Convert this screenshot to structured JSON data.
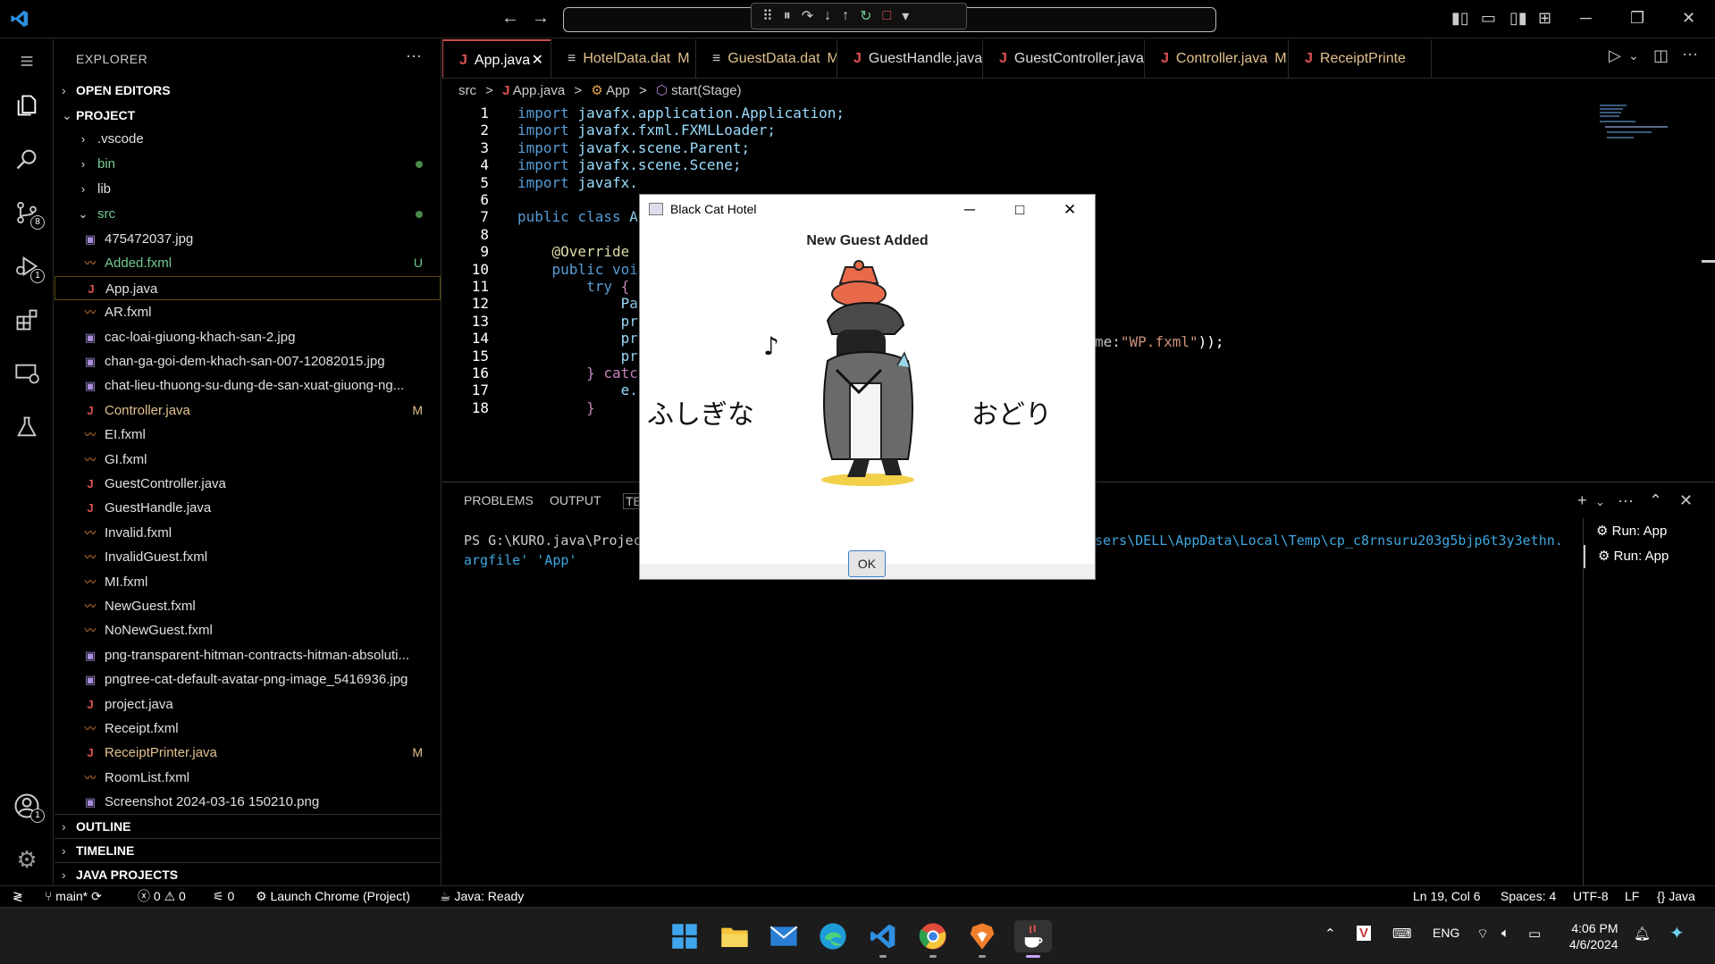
{
  "titlebar": {
    "back": "←",
    "forward": "→",
    "debug": [
      "⠿",
      "⏸",
      "↷",
      "↓",
      "↑",
      "↻",
      "□",
      "▾"
    ],
    "window": {
      "minimize": "─",
      "restore": "❐",
      "close": "✕"
    }
  },
  "activity": [
    {
      "icon": "files-icon",
      "badge": ""
    },
    {
      "icon": "search-icon",
      "badge": ""
    },
    {
      "icon": "source-control-icon",
      "badge": "8"
    },
    {
      "icon": "run-debug-icon",
      "badge": "1"
    },
    {
      "icon": "extensions-icon",
      "badge": ""
    },
    {
      "icon": "remote-explorer-icon",
      "badge": ""
    },
    {
      "icon": "testing-icon",
      "badge": ""
    },
    {
      "icon": "accounts-icon",
      "badge": "1"
    },
    {
      "icon": "settings-gear-icon",
      "badge": ""
    }
  ],
  "sidebar": {
    "title": "EXPLORER",
    "more": "···",
    "open_editors": "OPEN EDITORS",
    "project": "PROJECT",
    "outline": "OUTLINE",
    "timeline": "TIMELINE",
    "java_projects": "JAVA PROJECTS",
    "folders": [
      {
        "label": ".vscode"
      },
      {
        "label": "bin"
      },
      {
        "label": "lib"
      },
      {
        "label": "src"
      }
    ],
    "files": [
      {
        "label": "475472037.jpg",
        "type": "img",
        "badge": ""
      },
      {
        "label": "Added.fxml",
        "type": "xml",
        "badge": "U"
      },
      {
        "label": "App.java",
        "type": "java",
        "badge": ""
      },
      {
        "label": "AR.fxml",
        "type": "xml",
        "badge": ""
      },
      {
        "label": "cac-loai-giuong-khach-san-2.jpg",
        "type": "img",
        "badge": ""
      },
      {
        "label": "chan-ga-goi-dem-khach-san-007-12082015.jpg",
        "type": "img",
        "badge": ""
      },
      {
        "label": "chat-lieu-thuong-su-dung-de-san-xuat-giuong-ng...",
        "type": "img",
        "badge": ""
      },
      {
        "label": "Controller.java",
        "type": "java",
        "badge": "M"
      },
      {
        "label": "EI.fxml",
        "type": "xml",
        "badge": ""
      },
      {
        "label": "GI.fxml",
        "type": "xml",
        "badge": ""
      },
      {
        "label": "GuestController.java",
        "type": "java",
        "badge": ""
      },
      {
        "label": "GuestHandle.java",
        "type": "java",
        "badge": ""
      },
      {
        "label": "Invalid.fxml",
        "type": "xml",
        "badge": ""
      },
      {
        "label": "InvalidGuest.fxml",
        "type": "xml",
        "badge": ""
      },
      {
        "label": "MI.fxml",
        "type": "xml",
        "badge": ""
      },
      {
        "label": "NewGuest.fxml",
        "type": "xml",
        "badge": ""
      },
      {
        "label": "NoNewGuest.fxml",
        "type": "xml",
        "badge": ""
      },
      {
        "label": "png-transparent-hitman-contracts-hitman-absoluti...",
        "type": "img",
        "badge": ""
      },
      {
        "label": "pngtree-cat-default-avatar-png-image_5416936.jpg",
        "type": "img",
        "badge": ""
      },
      {
        "label": "project.java",
        "type": "java",
        "badge": ""
      },
      {
        "label": "Receipt.fxml",
        "type": "xml",
        "badge": ""
      },
      {
        "label": "ReceiptPrinter.java",
        "type": "java",
        "badge": "M"
      },
      {
        "label": "RoomList.fxml",
        "type": "xml",
        "badge": ""
      },
      {
        "label": "Screenshot 2024-03-16 150210.png",
        "type": "img",
        "badge": ""
      }
    ]
  },
  "tabs": [
    {
      "label": "App.java",
      "icon": "J",
      "suffix": "",
      "close": "✕"
    },
    {
      "label": "HotelData.dat",
      "icon": "≡",
      "suffix": "M",
      "close": ""
    },
    {
      "label": "GuestData.dat",
      "icon": "≡",
      "suffix": "M",
      "close": ""
    },
    {
      "label": "GuestHandle.java",
      "icon": "J",
      "suffix": "",
      "close": ""
    },
    {
      "label": "GuestController.java",
      "icon": "J",
      "suffix": "",
      "close": ""
    },
    {
      "label": "Controller.java",
      "icon": "J",
      "suffix": "M",
      "close": ""
    },
    {
      "label": "ReceiptPrinte",
      "icon": "J",
      "suffix": "",
      "close": ""
    }
  ],
  "breadcrumb": {
    "src": "src",
    "file": "App.java",
    "cls": "App",
    "method": "start(Stage)",
    "sep": ">"
  },
  "code": {
    "lines": [
      {
        "n": "1",
        "kw": "import ",
        "rest": "javafx.application.Application;",
        "str": "",
        "tail": ""
      },
      {
        "n": "2",
        "kw": "import ",
        "rest": "javafx.fxml.FXMLLoader;",
        "str": "",
        "tail": ""
      },
      {
        "n": "3",
        "kw": "import ",
        "rest": "javafx.scene.Parent;",
        "str": "",
        "tail": ""
      },
      {
        "n": "4",
        "kw": "import ",
        "rest": "javafx.scene.Scene;",
        "str": "",
        "tail": ""
      },
      {
        "n": "5",
        "kw": "import ",
        "rest": "javafx.",
        "str": "",
        "tail": ""
      },
      {
        "n": "6",
        "kw": "",
        "rest": "",
        "str": "",
        "tail": ""
      },
      {
        "n": "7",
        "kw": "public class ",
        "rest": "A",
        "str": "",
        "tail": ""
      },
      {
        "n": "8",
        "kw": "",
        "rest": "",
        "str": "",
        "tail": ""
      },
      {
        "n": "9",
        "kw": "    @Override",
        "rest": "",
        "str": "",
        "tail": ""
      },
      {
        "n": "10",
        "kw": "    public voi",
        "rest": "",
        "str": "",
        "tail": ""
      },
      {
        "n": "11",
        "kw": "        try ",
        "rest": "{",
        "str": "",
        "tail": ""
      },
      {
        "n": "12",
        "kw": "",
        "rest": "            Pa",
        "str": "",
        "tail": ""
      },
      {
        "n": "13",
        "kw": "",
        "rest": "            pr",
        "str": "",
        "tail": ""
      },
      {
        "n": "14",
        "kw": "",
        "rest": "            pr",
        "str": "",
        "tail": ""
      },
      {
        "n": "15",
        "kw": "",
        "rest": "            pr",
        "str": "",
        "tail": ""
      },
      {
        "n": "16",
        "kw": "",
        "rest": "        } catc",
        "str": "",
        "tail": ""
      },
      {
        "n": "17",
        "kw": "",
        "rest": "            e.",
        "str": "",
        "tail": ""
      },
      {
        "n": "18",
        "kw": "",
        "rest": "        }",
        "str": "",
        "tail": ""
      }
    ],
    "line12_right": {
      "pre": "me:",
      "str": "\"WP.fxml\"",
      "post": "));"
    }
  },
  "panel": {
    "problems": "PROBLEMS",
    "output": "OUTPUT",
    "terminal": "TE",
    "term_line1_left": "PS G:\\KURO.java\\Projec",
    "term_line1_right": "sers\\DELL\\AppData\\Local\\Temp\\cp_c8rnsuru203g5bjp6t3y3ethn.",
    "term_line2": "argfile' 'App'",
    "terminals": [
      "Run: App",
      "Run: App"
    ],
    "controls": {
      "add": "+",
      "more": "···",
      "max": "⌃",
      "close": "✕"
    }
  },
  "dialog": {
    "title": "Black Cat Hotel",
    "header": "New Guest Added",
    "ok": "OK",
    "jp_left": "ふしぎな",
    "jp_right": "おどり",
    "note": "♪",
    "ctl": {
      "min": "─",
      "max": "□",
      "close": "✕"
    }
  },
  "status": {
    "remote": "≷",
    "branch": "main*",
    "sync": "⟳",
    "errors": "0",
    "warnings": "0",
    "ports": "0",
    "launch": "Launch Chrome (Project)",
    "java": "Java: Ready",
    "position": "Ln 19, Col 6",
    "spaces": "Spaces: 4",
    "encoding": "UTF-8",
    "eol": "LF",
    "lang": "Java"
  },
  "taskbar": {
    "time": "4:06 PM",
    "date": "4/6/2024",
    "lang": "ENG",
    "tray_up": "⌃"
  },
  "colors": {
    "accent_tab": "#c94b4b",
    "java_icon": "#e05252",
    "modified": "#e2c08d",
    "untracked": "#73c991"
  }
}
